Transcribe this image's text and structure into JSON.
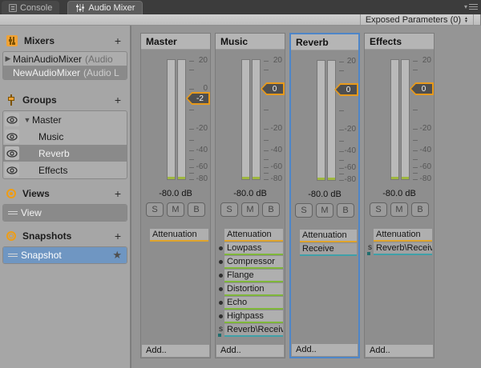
{
  "tabs": [
    {
      "label": "Console"
    },
    {
      "label": "Audio Mixer"
    }
  ],
  "toolbar": {
    "exposed_parameters": "Exposed Parameters (0)"
  },
  "sidebar": {
    "mixers": {
      "title": "Mixers",
      "add_label": "+",
      "items": [
        {
          "name": "MainAudioMixer",
          "suffix": "(Audio"
        },
        {
          "name": "NewAudioMixer",
          "suffix": "(Audio L"
        }
      ]
    },
    "groups": {
      "title": "Groups",
      "add_label": "+",
      "items": [
        {
          "label": "Master"
        },
        {
          "label": "Music"
        },
        {
          "label": "Reverb"
        },
        {
          "label": "Effects"
        }
      ]
    },
    "views": {
      "title": "Views",
      "add_label": "+",
      "items": [
        {
          "label": "View"
        }
      ]
    },
    "snapshots": {
      "title": "Snapshots",
      "add_label": "+",
      "items": [
        {
          "label": "Snapshot",
          "star": "★"
        }
      ]
    }
  },
  "channel_buttons": {
    "solo": "S",
    "mute": "M",
    "bypass": "B"
  },
  "meter_scale": {
    "labels": [
      "20",
      "0",
      "-20",
      "-40",
      "-60",
      "-80"
    ]
  },
  "strips": [
    {
      "title": "Master",
      "fader_value": "-2",
      "db_label": "-80.0 dB",
      "add_label": "Add..",
      "effects": [
        {
          "label": "Attenuation",
          "type": "attenuation"
        }
      ]
    },
    {
      "title": "Music",
      "fader_value": "0",
      "db_label": "-80.0 dB",
      "add_label": "Add..",
      "effects": [
        {
          "label": "Attenuation",
          "type": "attenuation"
        },
        {
          "label": "Lowpass",
          "type": "effect"
        },
        {
          "label": "Compressor",
          "type": "effect"
        },
        {
          "label": "Flange",
          "type": "effect"
        },
        {
          "label": "Distortion",
          "type": "effect"
        },
        {
          "label": "Echo",
          "type": "effect"
        },
        {
          "label": "Highpass",
          "type": "effect"
        },
        {
          "label": "Reverb\\Receiv",
          "type": "send",
          "prefix": "s"
        }
      ]
    },
    {
      "title": "Reverb",
      "fader_value": "0",
      "db_label": "-80.0 dB",
      "add_label": "Add..",
      "effects": [
        {
          "label": "Attenuation",
          "type": "attenuation"
        },
        {
          "label": "Receive",
          "type": "send"
        }
      ]
    },
    {
      "title": "Effects",
      "fader_value": "0",
      "db_label": "-80.0 dB",
      "add_label": "Add..",
      "effects": [
        {
          "label": "Attenuation",
          "type": "attenuation"
        },
        {
          "label": "Reverb\\Receiv",
          "type": "send",
          "prefix": "s"
        }
      ]
    }
  ],
  "colors": {
    "accent_orange": "#e89a1b",
    "effect_green": "#7fb73a",
    "send_teal": "#3fa0a8",
    "selection_blue": "#6f96c2",
    "strip_selection_border": "#4e86c8"
  }
}
